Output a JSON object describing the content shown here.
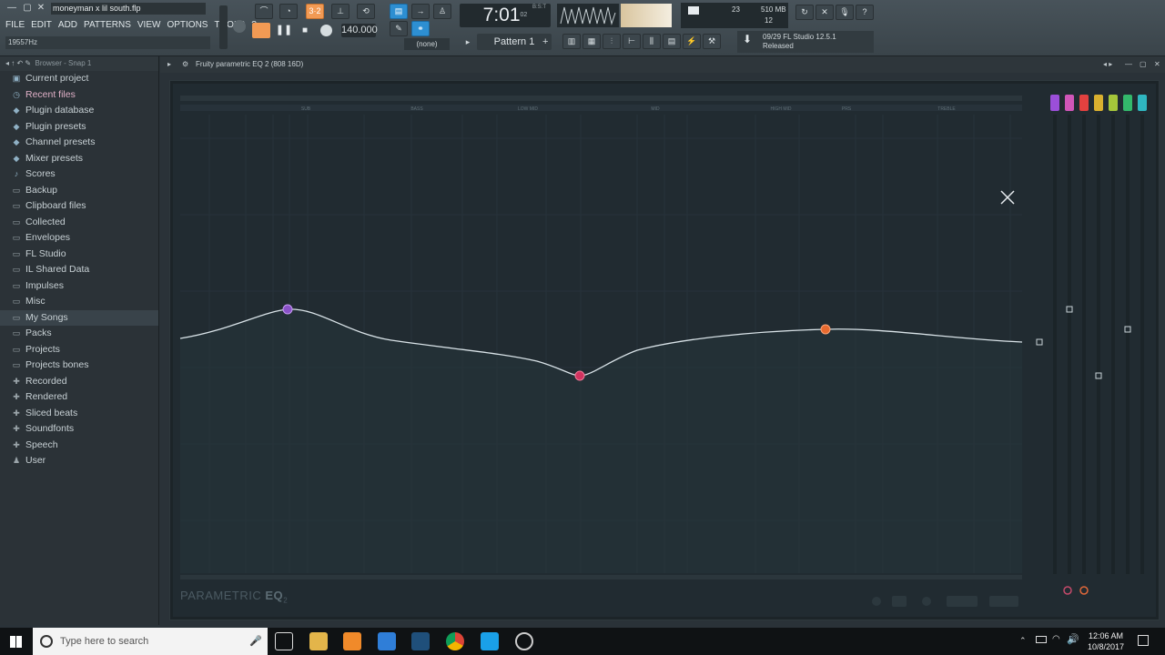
{
  "app": {
    "project_title": "moneyman x lil south.flp",
    "menu": [
      "FILE",
      "EDIT",
      "ADD",
      "PATTERNS",
      "VIEW",
      "OPTIONS",
      "TOOLS",
      "?"
    ],
    "hint": "19557Hz",
    "tempo": "140.000",
    "time_main": "7:01",
    "time_sub": "02",
    "time_unit": "B:S:T",
    "cpu_value": "23",
    "mem": "510 MB",
    "poly": "12",
    "pattern": "Pattern 1",
    "output_none": "(none)",
    "news_line1": "09/29  FL Studio 12.5.1",
    "news_line2": "Released"
  },
  "browser": {
    "header": "Browser - Snap 1",
    "items": [
      {
        "label": "Current project",
        "icon": "project-icon"
      },
      {
        "label": "Recent files",
        "icon": "recent-icon"
      },
      {
        "label": "Plugin database",
        "icon": "plugin-db-icon"
      },
      {
        "label": "Plugin presets",
        "icon": "plugin-presets-icon"
      },
      {
        "label": "Channel presets",
        "icon": "channel-presets-icon"
      },
      {
        "label": "Mixer presets",
        "icon": "mixer-presets-icon"
      },
      {
        "label": "Scores",
        "icon": "score-icon"
      },
      {
        "label": "Backup",
        "icon": "backup-icon"
      },
      {
        "label": "Clipboard files",
        "icon": "folder-icon"
      },
      {
        "label": "Collected",
        "icon": "folder-icon"
      },
      {
        "label": "Envelopes",
        "icon": "folder-icon"
      },
      {
        "label": "FL Studio",
        "icon": "folder-icon"
      },
      {
        "label": "IL Shared Data",
        "icon": "folder-icon"
      },
      {
        "label": "Impulses",
        "icon": "folder-icon"
      },
      {
        "label": "Misc",
        "icon": "folder-icon"
      },
      {
        "label": "My Songs",
        "icon": "folder-icon"
      },
      {
        "label": "Packs",
        "icon": "folder-icon"
      },
      {
        "label": "Projects",
        "icon": "folder-icon"
      },
      {
        "label": "Projects bones",
        "icon": "folder-icon"
      },
      {
        "label": "Recorded",
        "icon": "recorded-icon"
      },
      {
        "label": "Rendered",
        "icon": "rendered-icon"
      },
      {
        "label": "Sliced beats",
        "icon": "sliced-icon"
      },
      {
        "label": "Soundfonts",
        "icon": "soundfont-icon"
      },
      {
        "label": "Speech",
        "icon": "speech-icon"
      },
      {
        "label": "User",
        "icon": "user-icon"
      }
    ]
  },
  "plugin": {
    "title": "Fruity parametric EQ 2 (808 16D)",
    "brand_a": "PARAMETRIC",
    "brand_b": "EQ",
    "brand_c": "2",
    "band_labels": [
      "SUB",
      "BASS",
      "LOW MID",
      "MID",
      "HIGH MID",
      "PRS",
      "TREBLE"
    ],
    "colors": {
      "bg": "#212b31",
      "curve": "#d9e3e8",
      "grid": "#2c373d"
    }
  },
  "taskbar": {
    "search_placeholder": "Type here to search",
    "time": "12:06 AM",
    "date": "10/8/2017"
  }
}
